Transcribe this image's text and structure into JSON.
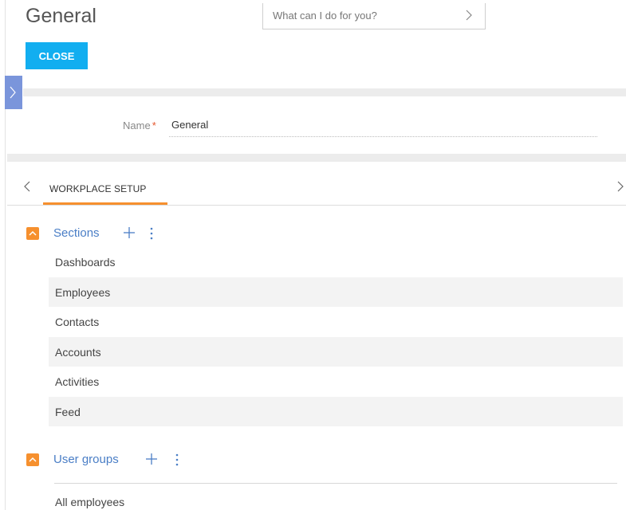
{
  "header": {
    "title": "General",
    "command_placeholder": "What can I do for you?",
    "close_label": "CLOSE"
  },
  "form": {
    "name_label": "Name",
    "required_mark": "*",
    "name_value": "General"
  },
  "tabs": [
    {
      "label": "WORKPLACE SETUP",
      "active": true
    }
  ],
  "sections_group": {
    "title": "Sections",
    "items": [
      "Dashboards",
      "Employees",
      "Contacts",
      "Accounts",
      "Activities",
      "Feed"
    ]
  },
  "user_groups": {
    "title": "User groups",
    "items": [
      "All employees"
    ]
  },
  "colors": {
    "accent_button": "#12aef0",
    "active_tab_underline": "#f6902e",
    "group_title": "#4a7ec6",
    "side_toggle": "#7a95db"
  },
  "icons": [
    "chevron-right-icon",
    "chevron-left-icon",
    "chevron-up-icon",
    "plus-icon",
    "more-vertical-icon"
  ]
}
